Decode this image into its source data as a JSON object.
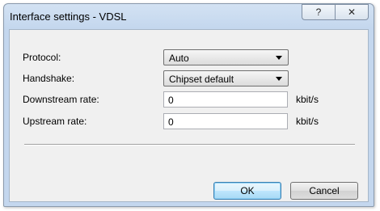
{
  "window": {
    "title": "Interface settings - VDSL",
    "help_glyph": "?",
    "close_glyph": "✕"
  },
  "form": {
    "protocol": {
      "label": "Protocol:",
      "value": "Auto"
    },
    "handshake": {
      "label": "Handshake:",
      "value": "Chipset default"
    },
    "downstream": {
      "label": "Downstream rate:",
      "value": "0",
      "unit": "kbit/s"
    },
    "upstream": {
      "label": "Upstream rate:",
      "value": "0",
      "unit": "kbit/s"
    }
  },
  "buttons": {
    "ok": "OK",
    "cancel": "Cancel"
  },
  "colors": {
    "titlebar": "#c4d7ee",
    "client": "#f0f0f0",
    "default_button": "#bee6fd"
  }
}
